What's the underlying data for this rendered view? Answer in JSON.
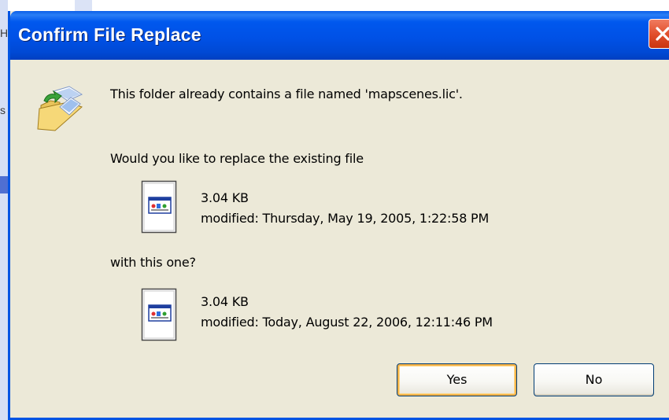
{
  "dialog": {
    "title": "Confirm File Replace",
    "message": "This folder already contains a file named 'mapscenes.lic'.",
    "question": "Would you like to replace the existing file",
    "with_text": "with this one?",
    "existing_file": {
      "size": "3.04 KB",
      "modified": "modified: Thursday, May 19, 2005, 1:22:58 PM"
    },
    "new_file": {
      "size": "3.04 KB",
      "modified": "modified: Today, August 22, 2006, 12:11:46 PM"
    },
    "buttons": {
      "yes": "Yes",
      "no": "No"
    }
  },
  "background": {
    "fragment_1": "H",
    "fragment_2": "s"
  },
  "icons": {
    "close": "close-icon",
    "folder": "folder-replace-icon",
    "file": "file-icon"
  },
  "colors": {
    "titlebar": "#0054e3",
    "dialog_bg": "#ece9d8",
    "close_button": "#e2502d",
    "default_button_focus": "#f8b347"
  }
}
